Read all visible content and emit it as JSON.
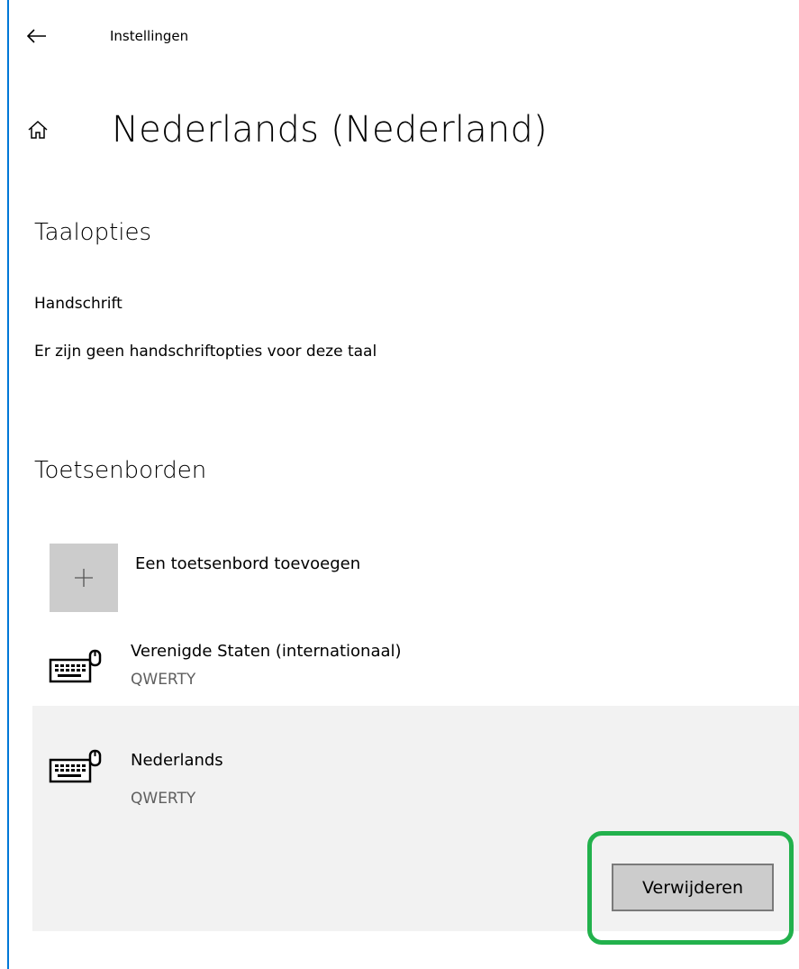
{
  "titlebar": {
    "back_icon": "back-arrow-icon",
    "app_title": "Instellingen"
  },
  "page": {
    "home_icon": "home-icon",
    "title": "Nederlands (Nederland)"
  },
  "language_options": {
    "heading": "Taalopties",
    "handwriting_label": "Handschrift",
    "handwriting_message": "Er zijn geen handschriftopties voor deze taal"
  },
  "keyboards": {
    "heading": "Toetsenborden",
    "add_icon": "plus-icon",
    "add_label": "Een toetsenbord toevoegen",
    "items": [
      {
        "icon": "keyboard-icon",
        "name": "Verenigde Staten (internationaal)",
        "layout": "QWERTY",
        "selected": false
      },
      {
        "icon": "keyboard-icon",
        "name": "Nederlands",
        "layout": "QWERTY",
        "selected": true
      }
    ],
    "remove_label": "Verwijderen"
  },
  "colors": {
    "accent": "#0078d7",
    "selected_row_bg": "#f2f2f2",
    "tile_bg": "#cccccc",
    "highlight_annotation": "#22b14c",
    "secondary_text": "#5f5f5f"
  }
}
